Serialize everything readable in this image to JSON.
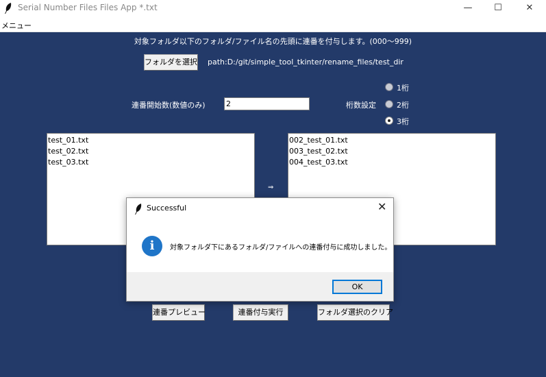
{
  "window": {
    "title": "Serial Number Files Files App *.txt",
    "minimize_glyph": "—",
    "maximize_glyph": "☐",
    "close_glyph": "✕"
  },
  "menubar": {
    "menu_label": "メニュー"
  },
  "main": {
    "instruction": "対象フォルダ以下のフォルダ/ファイル名の先頭に連番を付与します。(000〜999)",
    "select_folder_button": "フォルダを選択",
    "path_label": "path:D:/git/simple_tool_tkinter/rename_files/test_dir",
    "start_number_label": "連番開始数(数値のみ)",
    "start_number_value": "2",
    "digits_label": "桁数設定",
    "digit_options": [
      {
        "label": "1桁",
        "selected": false
      },
      {
        "label": "2桁",
        "selected": false
      },
      {
        "label": "3桁",
        "selected": true
      }
    ],
    "source_files": [
      "test_01.txt",
      "test_02.txt",
      "test_03.txt"
    ],
    "arrow": "⇒",
    "renamed_files": [
      "002_test_01.txt",
      "003_test_02.txt",
      "004_test_03.txt"
    ],
    "preview_button": "連番プレビュー",
    "execute_button": "連番付与実行",
    "clear_button": "フォルダ選択のクリア"
  },
  "dialog": {
    "title": "Successful",
    "close_glyph": "✕",
    "message": "対象フォルダ下にあるフォルダ/ファイルへの連番付与に成功しました。",
    "ok_label": "OK",
    "icon": "info-icon"
  },
  "colors": {
    "main_background": "#233a69",
    "dialog_accent": "#0078d7",
    "info_icon": "#1f75c8"
  }
}
